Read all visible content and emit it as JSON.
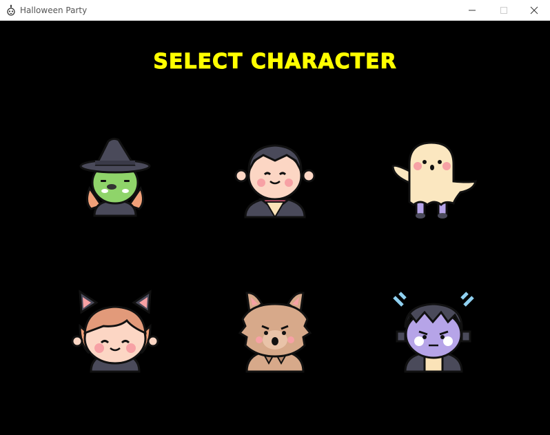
{
  "window": {
    "title": "Halloween Party",
    "icon": "skull-candle-icon"
  },
  "screen": {
    "heading": "SELECT CHARACTER",
    "heading_color": "#ffff00",
    "background_color": "#000000"
  },
  "characters": [
    {
      "id": "witch",
      "icon": "witch-icon"
    },
    {
      "id": "vampire",
      "icon": "vampire-icon"
    },
    {
      "id": "ghost",
      "icon": "ghost-icon"
    },
    {
      "id": "cat-girl",
      "icon": "cat-costume-icon"
    },
    {
      "id": "werewolf",
      "icon": "werewolf-icon"
    },
    {
      "id": "frankenstein",
      "icon": "frankenstein-icon"
    }
  ]
}
